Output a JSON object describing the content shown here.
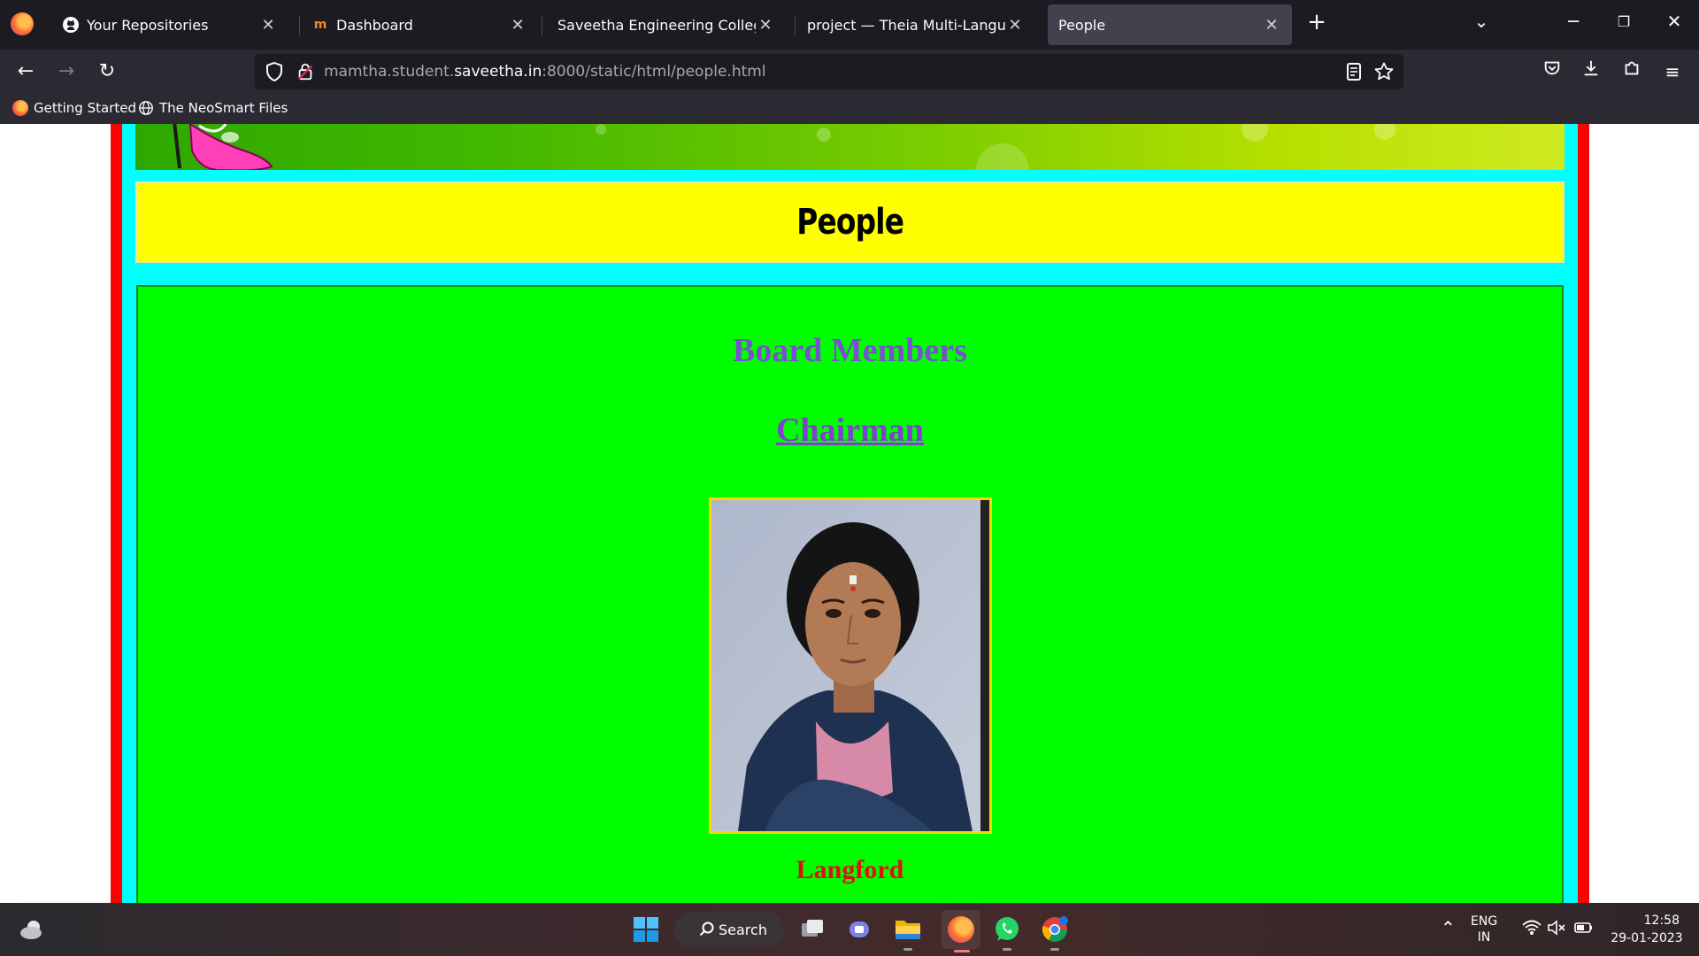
{
  "browser": {
    "tabs": [
      {
        "title": "Your Repositories",
        "icon": "github-icon",
        "active": false
      },
      {
        "title": "Dashboard",
        "icon": "dashboard-icon",
        "active": false
      },
      {
        "title": "Saveetha Engineering College",
        "icon": "",
        "active": false
      },
      {
        "title": "project — Theia Multi-Language Ex",
        "icon": "",
        "active": false
      },
      {
        "title": "People",
        "icon": "",
        "active": true
      }
    ],
    "url": {
      "prefix": "mamtha.student.",
      "domain": "saveetha.in",
      "suffix": ":8000/static/html/people.html"
    },
    "bookmarks": [
      {
        "label": "Getting Started",
        "icon": "firefox-icon"
      },
      {
        "label": "The NeoSmart Files",
        "icon": "globe-icon"
      }
    ]
  },
  "page": {
    "title": "People",
    "section_heading": "Board Members",
    "role_link": "Chairman",
    "person_name": "Langford"
  },
  "colors": {
    "outer_frame": "#ff0000",
    "inner_frame": "#00ffff",
    "title_background": "#ffff00",
    "content_background": "#00ff00",
    "heading_color": "#7a4fd0",
    "name_color": "#e01010"
  },
  "taskbar": {
    "search_label": "Search",
    "language_line1": "ENG",
    "language_line2": "IN",
    "time": "12:58",
    "date": "29-01-2023"
  }
}
